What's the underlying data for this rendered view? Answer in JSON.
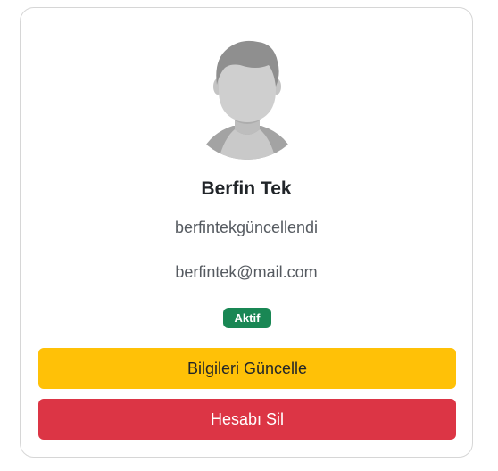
{
  "profile": {
    "name": "Berfin Tek",
    "username": "berfintekgüncellendi",
    "email": "berfintek@mail.com",
    "status": "Aktif",
    "avatar_icon": "user-avatar-icon"
  },
  "actions": {
    "update_label": "Bilgileri Güncelle",
    "delete_label": "Hesabı Sil"
  },
  "colors": {
    "status_badge": "#198754",
    "update_button": "#ffc107",
    "delete_button": "#dc3545"
  }
}
